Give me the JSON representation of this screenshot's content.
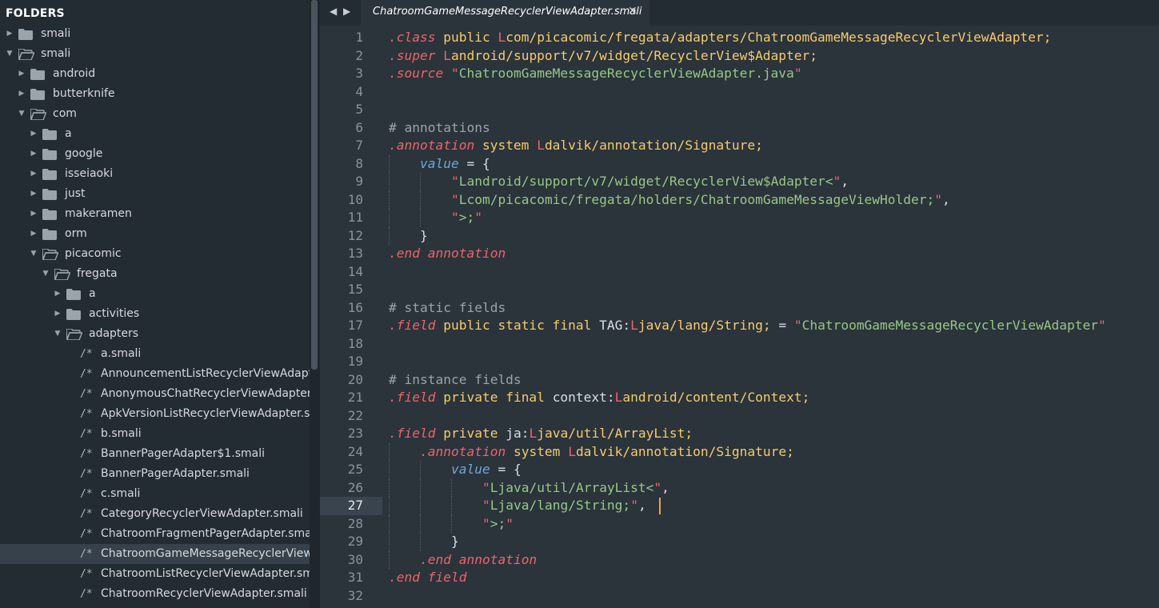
{
  "sidebar": {
    "header": "FOLDERS",
    "tree": [
      {
        "depth": 0,
        "kind": "folder",
        "open": false,
        "label": "smali"
      },
      {
        "depth": 0,
        "kind": "folder",
        "open": true,
        "label": "smali"
      },
      {
        "depth": 1,
        "kind": "folder",
        "open": false,
        "label": "android"
      },
      {
        "depth": 1,
        "kind": "folder",
        "open": false,
        "label": "butterknife"
      },
      {
        "depth": 1,
        "kind": "folder",
        "open": true,
        "label": "com"
      },
      {
        "depth": 2,
        "kind": "folder",
        "open": false,
        "label": "a"
      },
      {
        "depth": 2,
        "kind": "folder",
        "open": false,
        "label": "google"
      },
      {
        "depth": 2,
        "kind": "folder",
        "open": false,
        "label": "isseiaoki"
      },
      {
        "depth": 2,
        "kind": "folder",
        "open": false,
        "label": "just"
      },
      {
        "depth": 2,
        "kind": "folder",
        "open": false,
        "label": "makeramen"
      },
      {
        "depth": 2,
        "kind": "folder",
        "open": false,
        "label": "orm"
      },
      {
        "depth": 2,
        "kind": "folder",
        "open": true,
        "label": "picacomic"
      },
      {
        "depth": 3,
        "kind": "folder",
        "open": true,
        "label": "fregata"
      },
      {
        "depth": 4,
        "kind": "folder",
        "open": false,
        "label": "a"
      },
      {
        "depth": 4,
        "kind": "folder",
        "open": false,
        "label": "activities"
      },
      {
        "depth": 4,
        "kind": "folder",
        "open": true,
        "label": "adapters"
      },
      {
        "depth": 5,
        "kind": "file",
        "label": "a.smali"
      },
      {
        "depth": 5,
        "kind": "file",
        "label": "AnnouncementListRecyclerViewAdapte"
      },
      {
        "depth": 5,
        "kind": "file",
        "label": "AnonymousChatRecyclerViewAdapter.s"
      },
      {
        "depth": 5,
        "kind": "file",
        "label": "ApkVersionListRecyclerViewAdapter.sm"
      },
      {
        "depth": 5,
        "kind": "file",
        "label": "b.smali"
      },
      {
        "depth": 5,
        "kind": "file",
        "label": "BannerPagerAdapter$1.smali"
      },
      {
        "depth": 5,
        "kind": "file",
        "label": "BannerPagerAdapter.smali"
      },
      {
        "depth": 5,
        "kind": "file",
        "label": "c.smali"
      },
      {
        "depth": 5,
        "kind": "file",
        "label": "CategoryRecyclerViewAdapter.smali"
      },
      {
        "depth": 5,
        "kind": "file",
        "label": "ChatroomFragmentPagerAdapter.smali"
      },
      {
        "depth": 5,
        "kind": "file",
        "label": "ChatroomGameMessageRecyclerViewA",
        "selected": true
      },
      {
        "depth": 5,
        "kind": "file",
        "label": "ChatroomListRecyclerViewAdapter.sma"
      },
      {
        "depth": 5,
        "kind": "file",
        "label": "ChatroomRecyclerViewAdapter.smali"
      }
    ],
    "file_glyph": "/*"
  },
  "tabs": {
    "nav_left": "◀",
    "nav_right": "▶",
    "active_title": "ChatroomGameMessageRecyclerViewAdapter.smali",
    "close_label": "✕"
  },
  "editor": {
    "current_line": 27,
    "lines": [
      {
        "n": 1,
        "indent": 0,
        "tokens": [
          [
            "kw",
            ".class"
          ],
          [
            "pl",
            " "
          ],
          [
            "mod",
            "public"
          ],
          [
            "pl",
            " "
          ],
          [
            "L",
            "L"
          ],
          [
            "type",
            "com/picacomic/fregata/adapters/ChatroomGameMessageRecyclerViewAdapter;"
          ]
        ]
      },
      {
        "n": 2,
        "indent": 0,
        "tokens": [
          [
            "kw",
            ".super"
          ],
          [
            "pl",
            " "
          ],
          [
            "L",
            "L"
          ],
          [
            "type",
            "android/support/v7/widget/RecyclerView$Adapter;"
          ]
        ]
      },
      {
        "n": 3,
        "indent": 0,
        "tokens": [
          [
            "kw",
            ".source"
          ],
          [
            "pl",
            " "
          ],
          [
            "strq",
            "\""
          ],
          [
            "str",
            "ChatroomGameMessageRecyclerViewAdapter.java"
          ],
          [
            "strq",
            "\""
          ]
        ]
      },
      {
        "n": 4,
        "indent": 0,
        "tokens": []
      },
      {
        "n": 5,
        "indent": 0,
        "tokens": []
      },
      {
        "n": 6,
        "indent": 0,
        "tokens": [
          [
            "cm",
            "# annotations"
          ]
        ]
      },
      {
        "n": 7,
        "indent": 0,
        "tokens": [
          [
            "kw",
            ".annotation"
          ],
          [
            "pl",
            " "
          ],
          [
            "mod",
            "system"
          ],
          [
            "pl",
            " "
          ],
          [
            "L",
            "L"
          ],
          [
            "type",
            "dalvik/annotation/Signature;"
          ]
        ]
      },
      {
        "n": 8,
        "indent": 1,
        "tokens": [
          [
            "attr",
            "value"
          ],
          [
            "pl",
            " = {"
          ]
        ]
      },
      {
        "n": 9,
        "indent": 2,
        "tokens": [
          [
            "strq",
            "\""
          ],
          [
            "str",
            "Landroid/support/v7/widget/RecyclerView$Adapter<"
          ],
          [
            "strq",
            "\""
          ],
          [
            "pl",
            ","
          ]
        ]
      },
      {
        "n": 10,
        "indent": 2,
        "tokens": [
          [
            "strq",
            "\""
          ],
          [
            "str",
            "Lcom/picacomic/fregata/holders/ChatroomGameMessageViewHolder;"
          ],
          [
            "strq",
            "\""
          ],
          [
            "pl",
            ","
          ]
        ]
      },
      {
        "n": 11,
        "indent": 2,
        "tokens": [
          [
            "strq",
            "\""
          ],
          [
            "str",
            ">;"
          ],
          [
            "strq",
            "\""
          ]
        ]
      },
      {
        "n": 12,
        "indent": 1,
        "tokens": [
          [
            "pl",
            "}"
          ]
        ]
      },
      {
        "n": 13,
        "indent": 0,
        "tokens": [
          [
            "kw",
            ".end annotation"
          ]
        ]
      },
      {
        "n": 14,
        "indent": 0,
        "tokens": []
      },
      {
        "n": 15,
        "indent": 0,
        "tokens": []
      },
      {
        "n": 16,
        "indent": 0,
        "tokens": [
          [
            "cm",
            "# static fields"
          ]
        ]
      },
      {
        "n": 17,
        "indent": 0,
        "tokens": [
          [
            "kw",
            ".field"
          ],
          [
            "pl",
            " "
          ],
          [
            "mod",
            "public static final"
          ],
          [
            "pl",
            " "
          ],
          [
            "fld",
            "TAG"
          ],
          [
            "pl",
            ":"
          ],
          [
            "L",
            "L"
          ],
          [
            "type",
            "java/lang/String;"
          ],
          [
            "pl",
            " = "
          ],
          [
            "strq",
            "\""
          ],
          [
            "str",
            "ChatroomGameMessageRecyclerViewAdapter"
          ],
          [
            "strq",
            "\""
          ]
        ]
      },
      {
        "n": 18,
        "indent": 0,
        "tokens": []
      },
      {
        "n": 19,
        "indent": 0,
        "tokens": []
      },
      {
        "n": 20,
        "indent": 0,
        "tokens": [
          [
            "cm",
            "# instance fields"
          ]
        ]
      },
      {
        "n": 21,
        "indent": 0,
        "tokens": [
          [
            "kw",
            ".field"
          ],
          [
            "pl",
            " "
          ],
          [
            "mod",
            "private final"
          ],
          [
            "pl",
            " "
          ],
          [
            "fld",
            "context"
          ],
          [
            "pl",
            ":"
          ],
          [
            "L",
            "L"
          ],
          [
            "type",
            "android/content/Context;"
          ]
        ]
      },
      {
        "n": 22,
        "indent": 0,
        "tokens": []
      },
      {
        "n": 23,
        "indent": 0,
        "tokens": [
          [
            "kw",
            ".field"
          ],
          [
            "pl",
            " "
          ],
          [
            "mod",
            "private"
          ],
          [
            "pl",
            " "
          ],
          [
            "fld",
            "ja"
          ],
          [
            "pl",
            ":"
          ],
          [
            "L",
            "L"
          ],
          [
            "type",
            "java/util/ArrayList;"
          ]
        ]
      },
      {
        "n": 24,
        "indent": 1,
        "tokens": [
          [
            "kw",
            ".annotation"
          ],
          [
            "pl",
            " "
          ],
          [
            "mod",
            "system"
          ],
          [
            "pl",
            " "
          ],
          [
            "L",
            "L"
          ],
          [
            "type",
            "dalvik/annotation/Signature;"
          ]
        ]
      },
      {
        "n": 25,
        "indent": 2,
        "tokens": [
          [
            "attr",
            "value"
          ],
          [
            "pl",
            " = {"
          ]
        ]
      },
      {
        "n": 26,
        "indent": 3,
        "tokens": [
          [
            "strq",
            "\""
          ],
          [
            "str",
            "Ljava/util/ArrayList<"
          ],
          [
            "strq",
            "\""
          ],
          [
            "pl",
            ","
          ]
        ]
      },
      {
        "n": 27,
        "indent": 3,
        "tokens": [
          [
            "strq",
            "\""
          ],
          [
            "str",
            "Ljava/lang/String;"
          ],
          [
            "strq",
            "\""
          ],
          [
            "pl",
            ","
          ]
        ]
      },
      {
        "n": 28,
        "indent": 3,
        "tokens": [
          [
            "strq",
            "\""
          ],
          [
            "str",
            ">;"
          ],
          [
            "strq",
            "\""
          ]
        ]
      },
      {
        "n": 29,
        "indent": 2,
        "tokens": [
          [
            "pl",
            "}"
          ]
        ]
      },
      {
        "n": 30,
        "indent": 1,
        "tokens": [
          [
            "kw",
            ".end annotation"
          ]
        ]
      },
      {
        "n": 31,
        "indent": 0,
        "tokens": [
          [
            "kw",
            ".end field"
          ]
        ]
      },
      {
        "n": 32,
        "indent": 0,
        "tokens": []
      }
    ]
  },
  "colors": {
    "background": "#2b333b",
    "sidebar": "#232b33",
    "keyword": "#ec6569",
    "type": "#f6cb6b",
    "string": "#97c885",
    "comment": "#9aa3ab",
    "attribute": "#6fa8dc",
    "caret": "#f0a34a"
  }
}
